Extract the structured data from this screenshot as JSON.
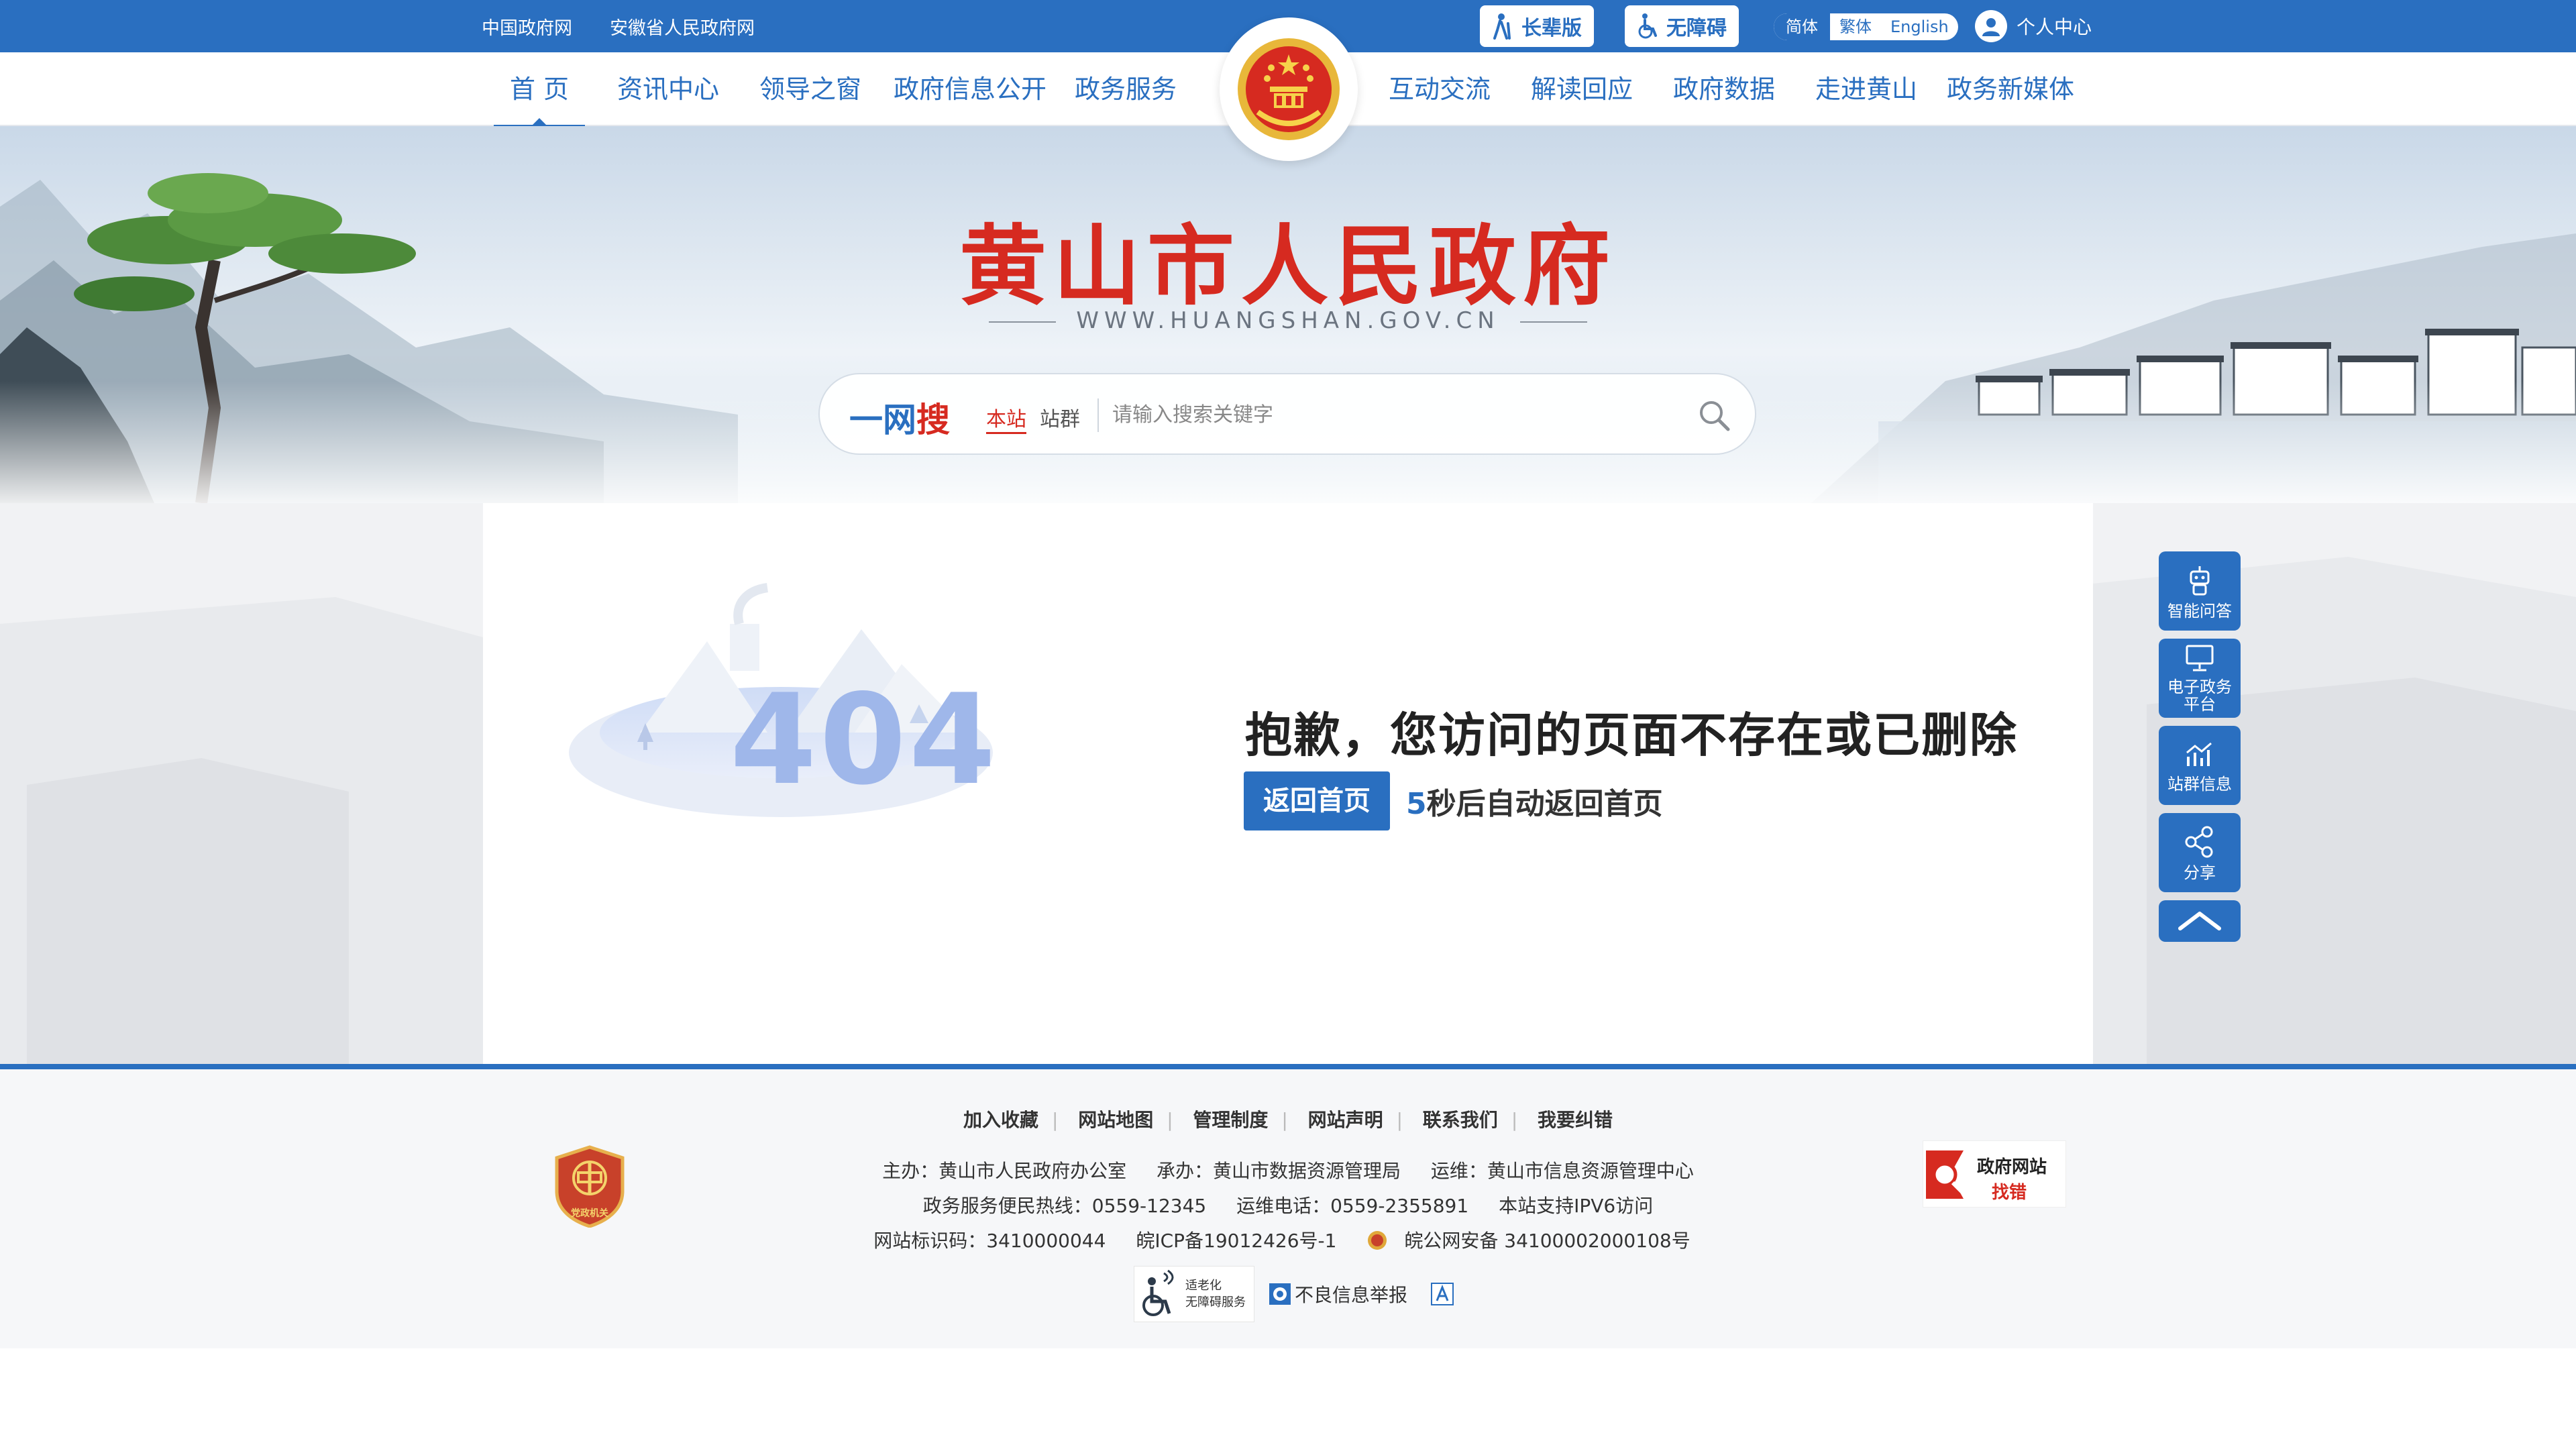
{
  "topbar": {
    "links": [
      "中国政府网",
      "安徽省人民政府网"
    ],
    "elder_label": "长辈版",
    "accessible_label": "无障碍",
    "languages": [
      "简体",
      "繁体",
      "English"
    ],
    "personal_label": "个人中心"
  },
  "nav": {
    "items": [
      "首 页",
      "资讯中心",
      "领导之窗",
      "政府信息公开",
      "政务服务",
      "互动交流",
      "解读回应",
      "政府数据",
      "走进黄山",
      "政务新媒体"
    ],
    "active_index": 0
  },
  "banner": {
    "title": "黄山市人民政府",
    "url": "WWW.HUANGSHAN.GOV.CN"
  },
  "search": {
    "brand_part1": "一网",
    "brand_part2": "搜",
    "scope_active": "本站",
    "scope_other": "站群",
    "placeholder": "请输入搜索关键字"
  },
  "error": {
    "code": "404",
    "message": "抱歉，您访问的页面不存在或已删除",
    "home_button": "返回首页",
    "countdown_seconds": "5",
    "countdown_text": "秒后自动返回首页"
  },
  "side_panel": {
    "items": [
      "智能问答",
      "电子政务平台",
      "站群信息",
      "分享"
    ],
    "item2_line1": "电子政务",
    "item2_line2": "平台"
  },
  "footer": {
    "links": [
      "加入收藏",
      "网站地图",
      "管理制度",
      "网站声明",
      "联系我们",
      "我要纠错"
    ],
    "host": "主办：黄山市人民政府办公室",
    "organizer": "承办：黄山市数据资源管理局",
    "operator": "运维：黄山市信息资源管理中心",
    "hotline": "政务服务便民热线：0559-12345",
    "ops_phone": "运维电话：0559-2355891",
    "ipv6": "本站支持IPV6访问",
    "site_id": "网站标识码：3410000044",
    "icp": "皖ICP备19012426号-1",
    "police": "皖公网安备 34100002000108号",
    "elder_service_line1": "适老化",
    "elder_service_line2": "无障碍服务",
    "report_label": "不良信息举报",
    "gov_error_line1": "政府网站",
    "gov_error_line2": "找错",
    "party_badge": "党政机关"
  },
  "colors": {
    "primary": "#2a6fc0",
    "title_red": "#d62a20",
    "page_bg": "#f1f2f4"
  }
}
